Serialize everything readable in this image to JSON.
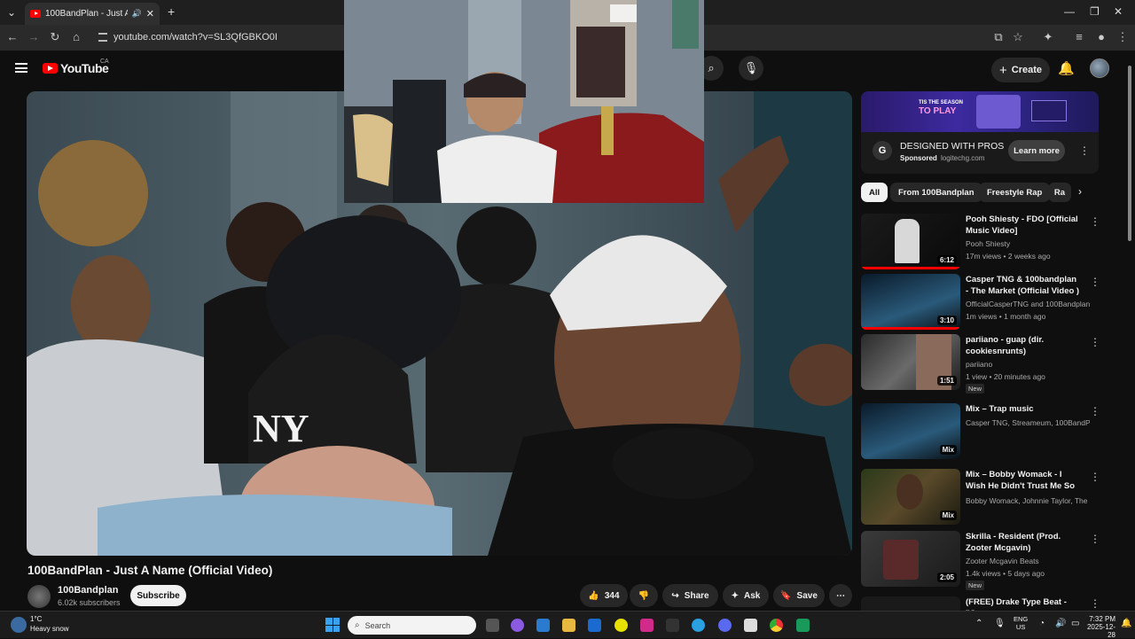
{
  "browser": {
    "tab_title": "100BandPlan - Just A Name",
    "url": "youtube.com/watch?v=SL3QfGBKO0I"
  },
  "masthead": {
    "logo_text": "YouTube",
    "country": "CA",
    "create_label": "Create"
  },
  "video": {
    "title": "100BandPlan - Just A Name (Official Video)",
    "channel_name": "100Bandplan",
    "subscribers": "6.02k subscribers",
    "subscribe_label": "Subscribe",
    "likes": "344",
    "share_label": "Share",
    "ask_label": "Ask",
    "save_label": "Save"
  },
  "ad": {
    "banner_line1": "TIS THE SEASON",
    "banner_line2": "TO PLAY",
    "headline": "DESIGNED WITH PROS",
    "sponsored": "Sponsored",
    "domain": "logitechg.com",
    "cta": "Learn more"
  },
  "chips": [
    "All",
    "From 100Bandplan",
    "Freestyle Rap",
    "Ra"
  ],
  "recommendations": [
    {
      "title": "Pooh Shiesty - FDO [Official Music Video]",
      "channel": "Pooh Shiesty",
      "meta": "17m views • 2 weeks ago",
      "duration": "6:12",
      "badge": "",
      "watched": 1.0
    },
    {
      "title": "Casper TNG & 100bandplan - The Market (Official Video ) ...",
      "channel": "OfficialCasperTNG and 100Bandplan",
      "meta": "1m views • 1 month ago",
      "duration": "3:10",
      "badge": "",
      "watched": 1.0
    },
    {
      "title": "pariiano - guap (dir. cookiesnrunts)",
      "channel": "pariiano",
      "meta": "1 view • 20 minutes ago",
      "duration": "1:51",
      "badge": "New",
      "watched": 0
    },
    {
      "title": "Mix – Trap music",
      "channel": "Casper TNG, Streameum, 100BandPlan a...",
      "meta": "",
      "duration": "Mix",
      "badge": "",
      "watched": 0
    },
    {
      "title": "Mix – Bobby Womack - I Wish He Didn't Trust Me So Much",
      "channel": "Bobby Womack, Johnnie Taylor, The O'Ja...",
      "meta": "",
      "duration": "Mix",
      "badge": "",
      "watched": 0
    },
    {
      "title": "Skrilla - Resident (Prod. Zooter Mcgavin)",
      "channel": "Zooter Mcgavin Beats",
      "meta": "1.4k views • 5 days ago",
      "duration": "2:05",
      "badge": "New",
      "watched": 0
    },
    {
      "title": "(FREE) Drake Type Beat - \"One",
      "channel": "",
      "meta": "",
      "duration": "",
      "badge": "",
      "watched": 0
    }
  ],
  "taskbar": {
    "weather_temp": "1°C",
    "weather_desc": "Heavy snow",
    "search_placeholder": "Search",
    "lang1": "ENG",
    "lang2": "US",
    "time": "7:32 PM",
    "date": "2025-12-28"
  },
  "colors": {
    "accent": "#ff0000",
    "background": "#0f0f0f",
    "surface": "#272727"
  }
}
